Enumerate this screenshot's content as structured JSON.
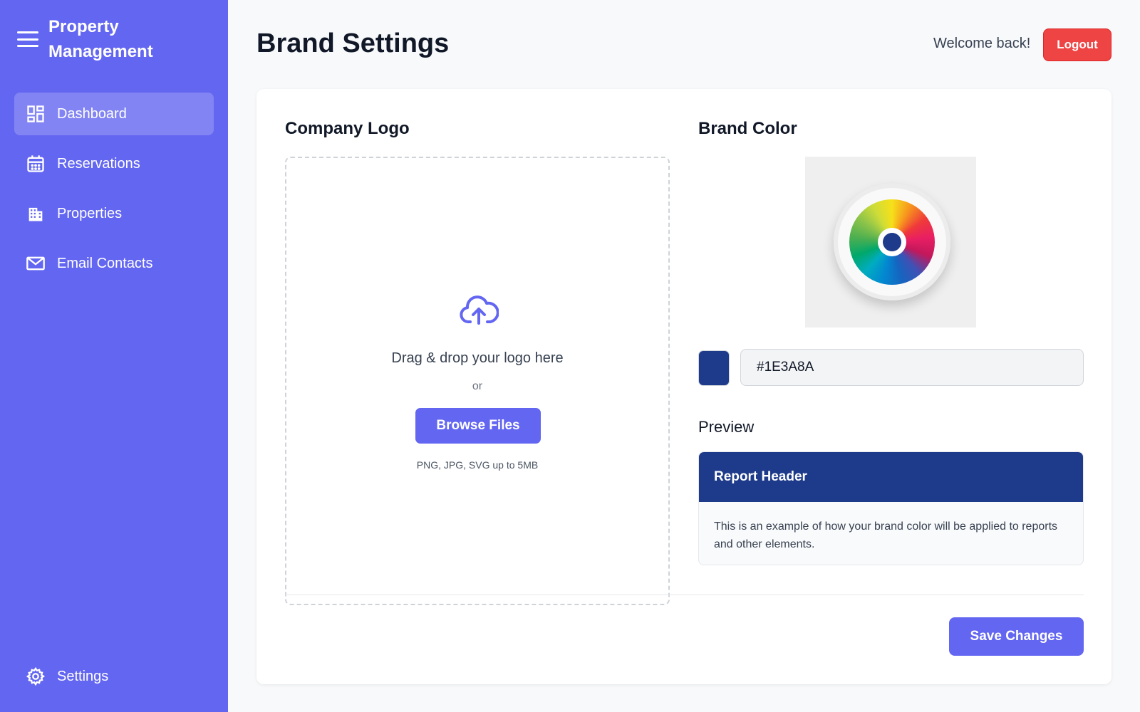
{
  "app": {
    "title": "Property Management"
  },
  "sidebar": {
    "items": [
      {
        "label": "Dashboard",
        "icon": "dashboard-icon",
        "active": true
      },
      {
        "label": "Reservations",
        "icon": "calendar-icon",
        "active": false
      },
      {
        "label": "Properties",
        "icon": "building-icon",
        "active": false
      },
      {
        "label": "Email Contacts",
        "icon": "mail-icon",
        "active": false
      }
    ],
    "settings": {
      "label": "Settings",
      "icon": "gear-icon"
    }
  },
  "header": {
    "title": "Brand Settings",
    "welcome": "Welcome back!",
    "logout_label": "Logout"
  },
  "logo_section": {
    "title": "Company Logo",
    "drag_text": "Drag & drop your logo here",
    "or_text": "or",
    "browse_label": "Browse Files",
    "hint": "PNG, JPG, SVG up to 5MB",
    "icon": "cloud-upload-icon"
  },
  "color_section": {
    "title": "Brand Color",
    "hex_value": "#1E3A8A",
    "preview_label": "Preview",
    "preview_header": "Report Header",
    "preview_text": "This is an example of how your brand color will be applied to reports and other elements."
  },
  "actions": {
    "save_label": "Save Changes"
  },
  "colors": {
    "sidebar": "#6366f1",
    "accent": "#6366f1",
    "brand": "#1E3A8A",
    "logout": "#ef4444"
  }
}
